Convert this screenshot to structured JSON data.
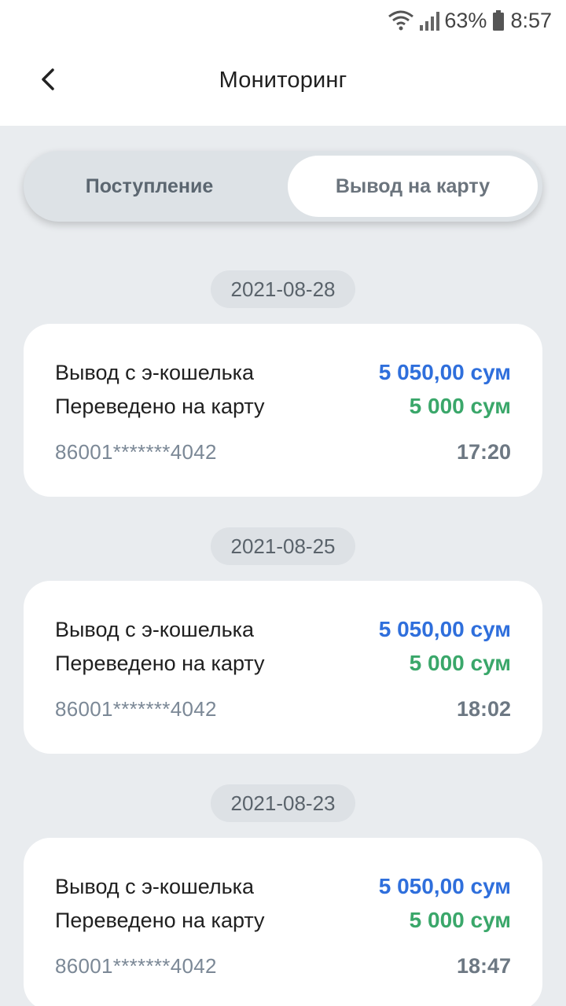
{
  "status": {
    "battery": "63%",
    "time": "8:57"
  },
  "header": {
    "title": "Мониторинг"
  },
  "tabs": [
    {
      "label": "Поступление",
      "active": false
    },
    {
      "label": "Вывод на карту",
      "active": true
    }
  ],
  "transactions": [
    {
      "date": "2021-08-28",
      "withdraw_label": "Вывод с э-кошелька",
      "withdraw_amount": "5 050,00 сум",
      "transfer_label": "Переведено на карту",
      "transfer_amount": "5 000 сум",
      "card_number": "86001*******4042",
      "time": "17:20"
    },
    {
      "date": "2021-08-25",
      "withdraw_label": "Вывод с э-кошелька",
      "withdraw_amount": "5 050,00 сум",
      "transfer_label": "Переведено на карту",
      "transfer_amount": "5 000 сум",
      "card_number": "86001*******4042",
      "time": "18:02"
    },
    {
      "date": "2021-08-23",
      "withdraw_label": "Вывод с э-кошелька",
      "withdraw_amount": "5 050,00 сум",
      "transfer_label": "Переведено на карту",
      "transfer_amount": "5 000 сум",
      "card_number": "86001*******4042",
      "time": "18:47"
    }
  ],
  "colors": {
    "accent_blue": "#2f6fdc",
    "accent_green": "#3aa76a",
    "background": "#e9ecef"
  },
  "icons": {
    "back": "chevron-left-icon",
    "wifi": "wifi-icon",
    "signal": "signal-icon",
    "battery": "battery-icon"
  }
}
